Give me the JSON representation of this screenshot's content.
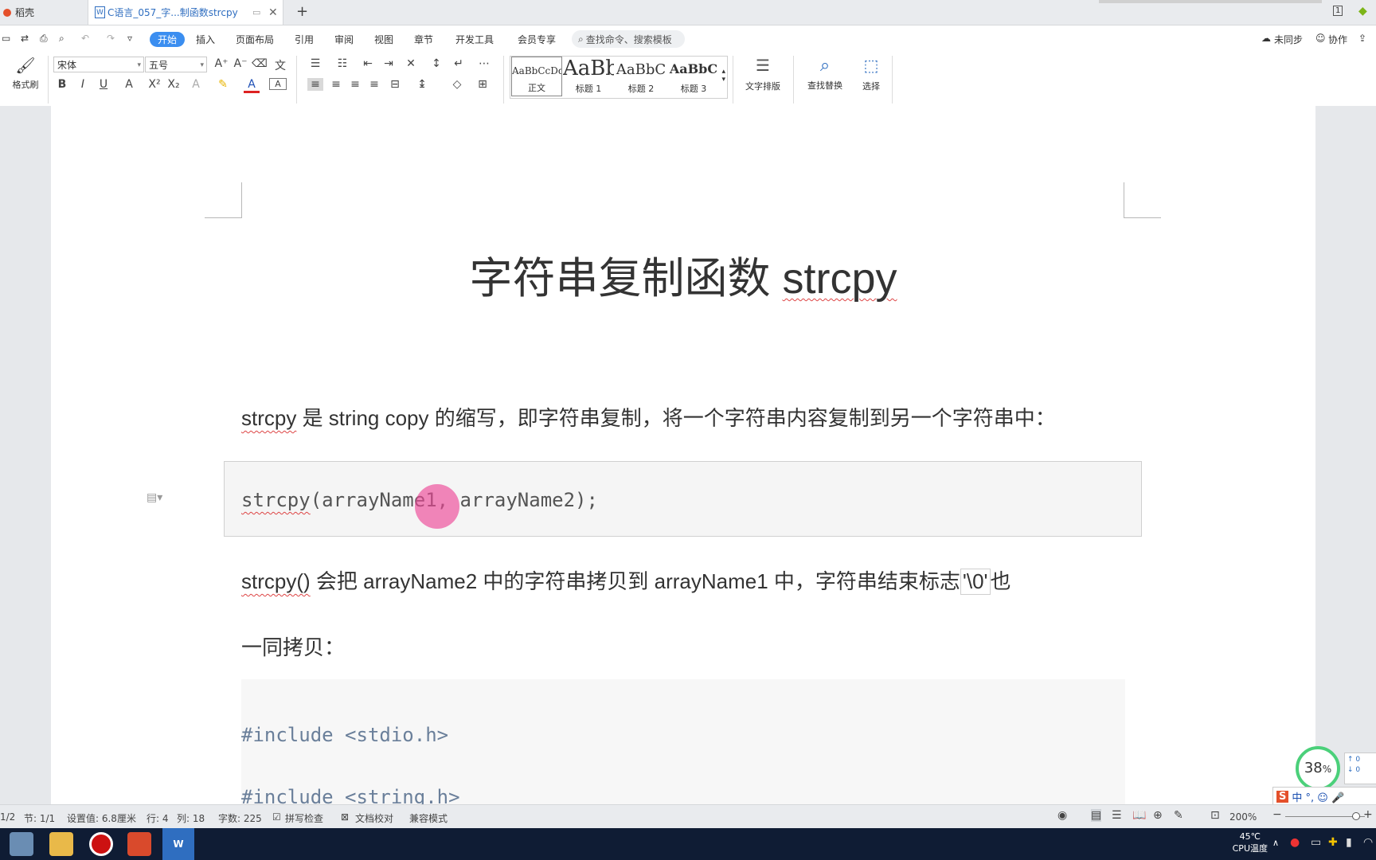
{
  "tabs": {
    "home_label": "稻壳",
    "doc_label": "C语言_057_字...制函数strcpy",
    "doc_icon_letter": "W",
    "add_label": "+"
  },
  "menu": {
    "items": [
      "开始",
      "插入",
      "页面布局",
      "引用",
      "审阅",
      "视图",
      "章节",
      "开发工具",
      "会员专享"
    ],
    "search_placeholder": "查找命令、搜索模板",
    "sync_label": "未同步",
    "collab_label": "协作"
  },
  "ribbon": {
    "format_painter": "格式刷",
    "font_name": "宋体",
    "font_size": "五号",
    "styles": [
      {
        "sample": "AaBbCcDd",
        "label": "正文"
      },
      {
        "sample": "AaBb",
        "label": "标题 1"
      },
      {
        "sample": "AaBbC",
        "label": "标题 2"
      },
      {
        "sample": "AaBbC",
        "label": "标题 3"
      }
    ],
    "text_layout": "文字排版",
    "find_replace": "查找替换",
    "select": "选择"
  },
  "document": {
    "title_cn": "字符串复制函数",
    "title_en": "strcpy",
    "para1_word": "strcpy",
    "para1_rest": " 是 string copy 的缩写，即字符串复制，将一个字符串内容复制到另一个字符串中：",
    "code1_fn": "strcpy",
    "code1_rest": "(arrayName1, arrayName2);",
    "para2_word": "strcpy()",
    "para2_mid": " 会把 arrayName2 中的字符串拷贝到 arrayName1 中，字符串结束标志",
    "para2_quote": "'\\0'",
    "para2_tail": "也",
    "para3": "一同拷贝：",
    "code2_line1_kw": "#include",
    "code2_line1_rest": " <stdio.h>",
    "code2_line2": "#include <string.h>"
  },
  "status": {
    "page": "1/2",
    "section": "节: 1/1",
    "setting": "设置值: 6.8厘米",
    "row": "行: 4",
    "col": "列: 18",
    "word_count": "字数: 225",
    "spell": "拼写检查",
    "proof": "文档校对",
    "compat": "兼容模式",
    "zoom": "200%"
  },
  "widget": {
    "percent": "38",
    "percent_sign": "%",
    "ime": "中 °, ☺ 🎤"
  },
  "taskbar": {
    "cpu_temp": "45℃",
    "cpu_label": "CPU温度"
  }
}
